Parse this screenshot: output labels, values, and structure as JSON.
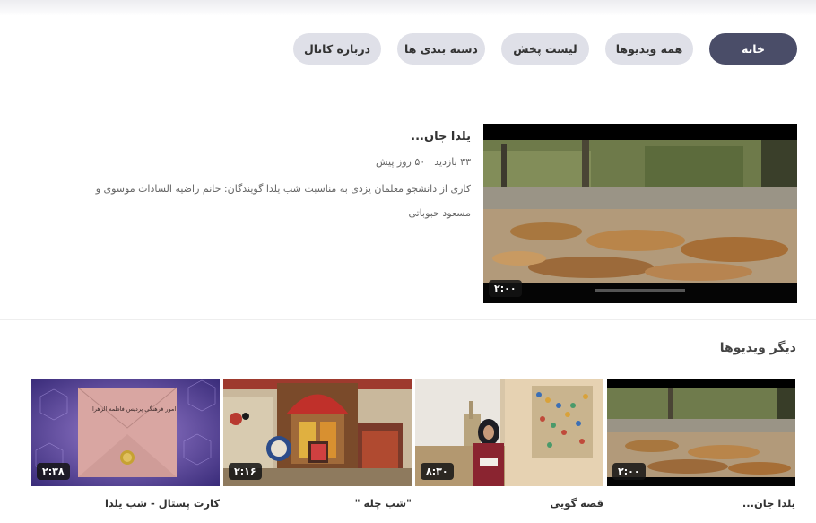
{
  "tabs": [
    {
      "label": "خانه",
      "active": true,
      "width": 98
    },
    {
      "label": "همه ویدیوها",
      "active": false,
      "width": 98
    },
    {
      "label": "لیست پخش",
      "active": false,
      "width": 98
    },
    {
      "label": "دسته بندی ها",
      "active": false,
      "width": 98
    },
    {
      "label": "درباره کانال",
      "active": false,
      "width": 98
    }
  ],
  "featured": {
    "title": "یلدا جان...",
    "views": "۳۳ بازدید",
    "age": "۵۰ روز پیش",
    "description": "کاری از دانشجو معلمان یزدی به مناسبت شب یلدا گویندگان: خانم راضیه السادات موسوی و مسعود حبوباتی",
    "duration": "۲:۰۰"
  },
  "section_title": "دیگر ویدیوها",
  "videos": [
    {
      "title": "یلدا جان...",
      "duration": "۲:۰۰"
    },
    {
      "title": "قصه گویی",
      "duration": "۸:۳۰"
    },
    {
      "title": "\"شب چله \"",
      "duration": "۲:۱۶"
    },
    {
      "title": "کارت پستال - شب یلدا",
      "duration": "۲:۳۸"
    }
  ],
  "thumbnail_captions": {
    "envelope": "امور فرهنگی پردیس فاطمه الزهرا"
  },
  "colors": {
    "tab_active": "#4a4d68",
    "tab_inactive": "#dfe0e8"
  }
}
